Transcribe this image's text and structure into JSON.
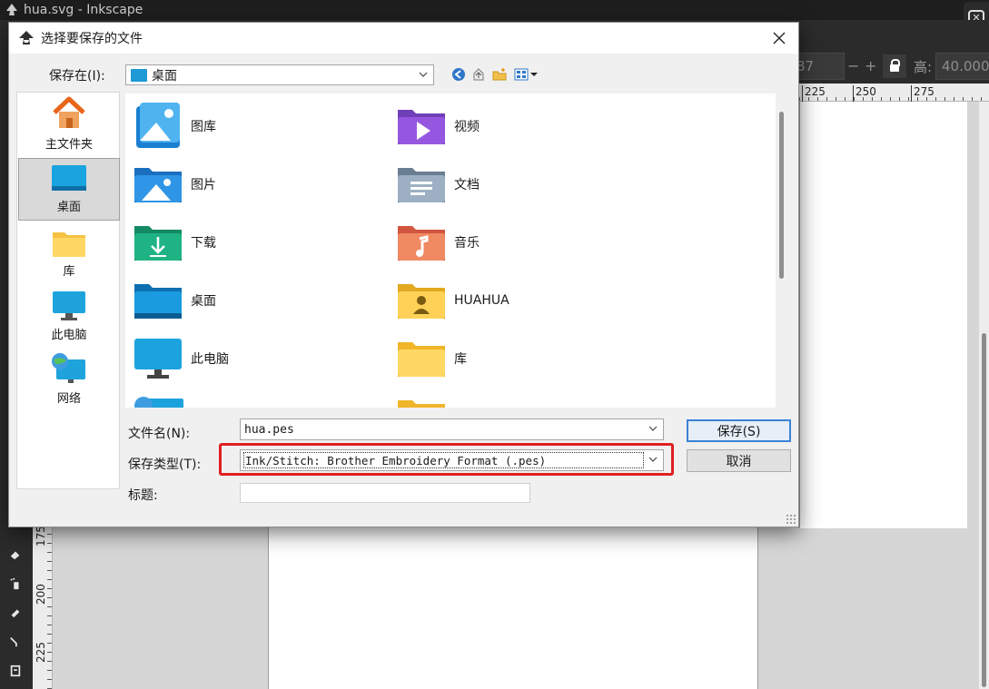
{
  "app": {
    "window_title": "hua.svg - Inkscape",
    "toolbar": {
      "field1": "87",
      "minus": "−",
      "plus": "+",
      "height_label": "高:",
      "height_value": "40.000"
    },
    "ruler_top": [
      "225",
      "250",
      "275"
    ],
    "ruler_left": [
      "175",
      "200",
      "225"
    ]
  },
  "dialog": {
    "title": "选择要保存的文件",
    "save_in_label": "保存在(I):",
    "save_in_value": "桌面",
    "places": [
      {
        "label": "主文件夹",
        "icon": "home-icon"
      },
      {
        "label": "桌面",
        "icon": "desktop-icon",
        "selected": true
      },
      {
        "label": "库",
        "icon": "library-folder-icon"
      },
      {
        "label": "此电脑",
        "icon": "computer-icon"
      },
      {
        "label": "网络",
        "icon": "network-icon"
      }
    ],
    "files": [
      {
        "label": "图库",
        "icon": "gallery-folder-icon"
      },
      {
        "label": "视频",
        "icon": "videos-folder-icon"
      },
      {
        "label": "图片",
        "icon": "pictures-folder-icon"
      },
      {
        "label": "文档",
        "icon": "documents-folder-icon"
      },
      {
        "label": "下载",
        "icon": "downloads-folder-icon"
      },
      {
        "label": "音乐",
        "icon": "music-folder-icon"
      },
      {
        "label": "桌面",
        "icon": "desktop-folder-icon"
      },
      {
        "label": "HUAHUA",
        "icon": "user-folder-icon"
      },
      {
        "label": "此电脑",
        "icon": "computer-icon"
      },
      {
        "label": "库",
        "icon": "library-folder-icon"
      }
    ],
    "filename_label": "文件名(N):",
    "filename_value": "hua.pes",
    "filetype_label": "保存类型(T):",
    "filetype_value": "Ink/Stitch: Brother Embroidery Format (.pes)",
    "title_label": "标题:",
    "title_value": "",
    "save_button": "保存(S)",
    "cancel_button": "取消",
    "highlight_color": "#e02020"
  }
}
